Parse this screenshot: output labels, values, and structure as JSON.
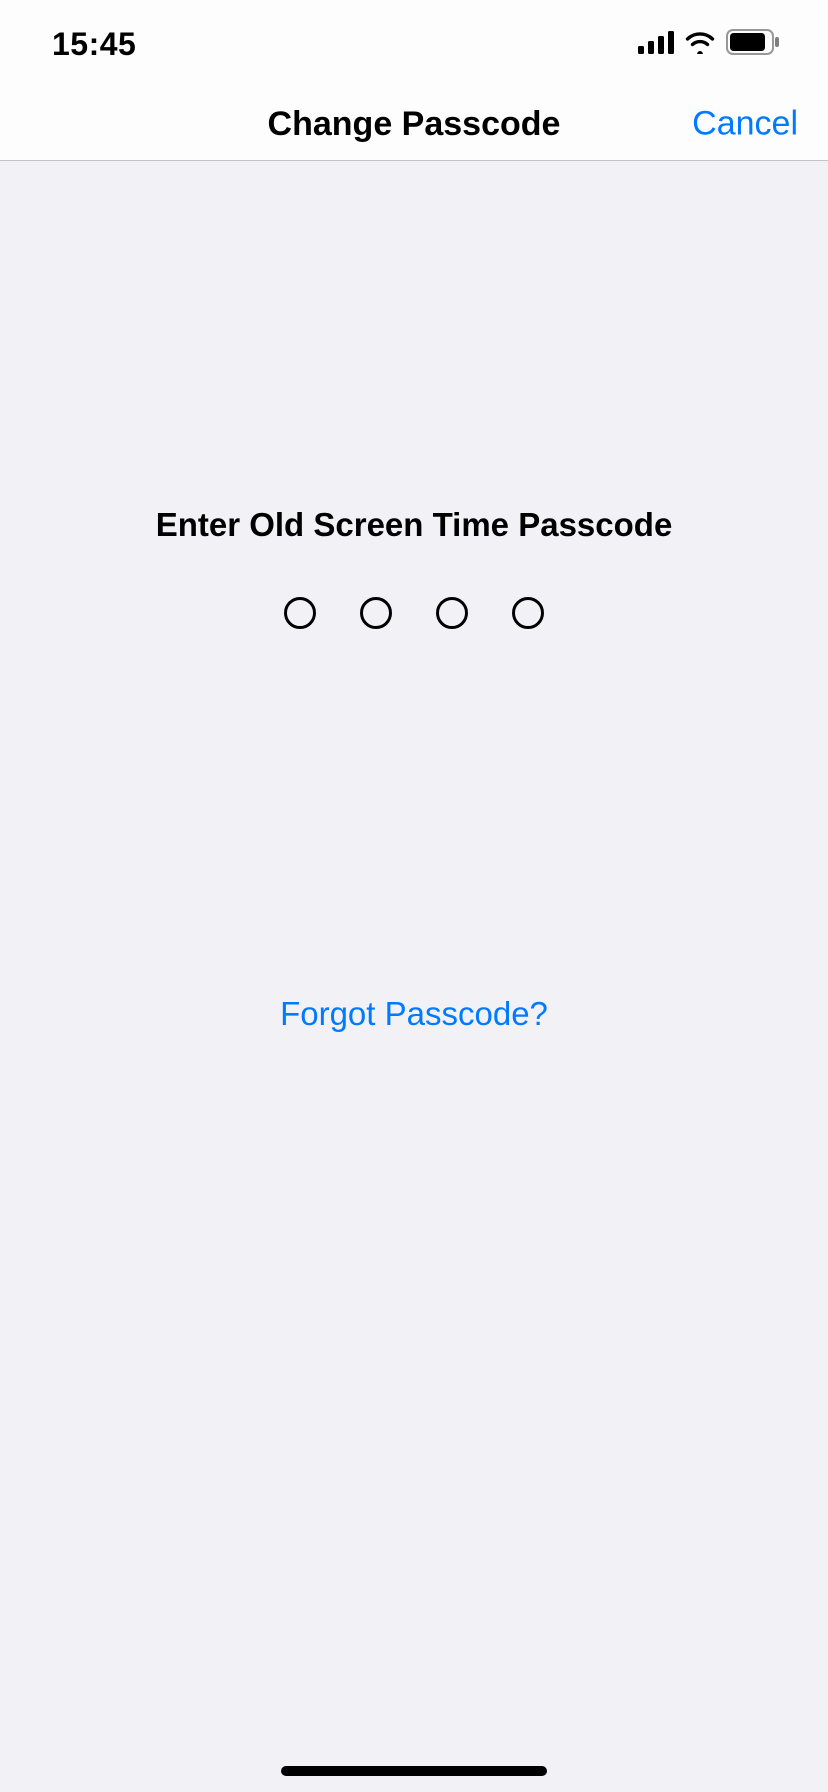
{
  "statusbar": {
    "time": "15:45"
  },
  "nav": {
    "title": "Change Passcode",
    "cancel_label": "Cancel"
  },
  "passcode": {
    "prompt": "Enter Old Screen Time Passcode",
    "digits_total": 4,
    "digits_filled": 0
  },
  "forgot": {
    "label": "Forgot Passcode?"
  }
}
